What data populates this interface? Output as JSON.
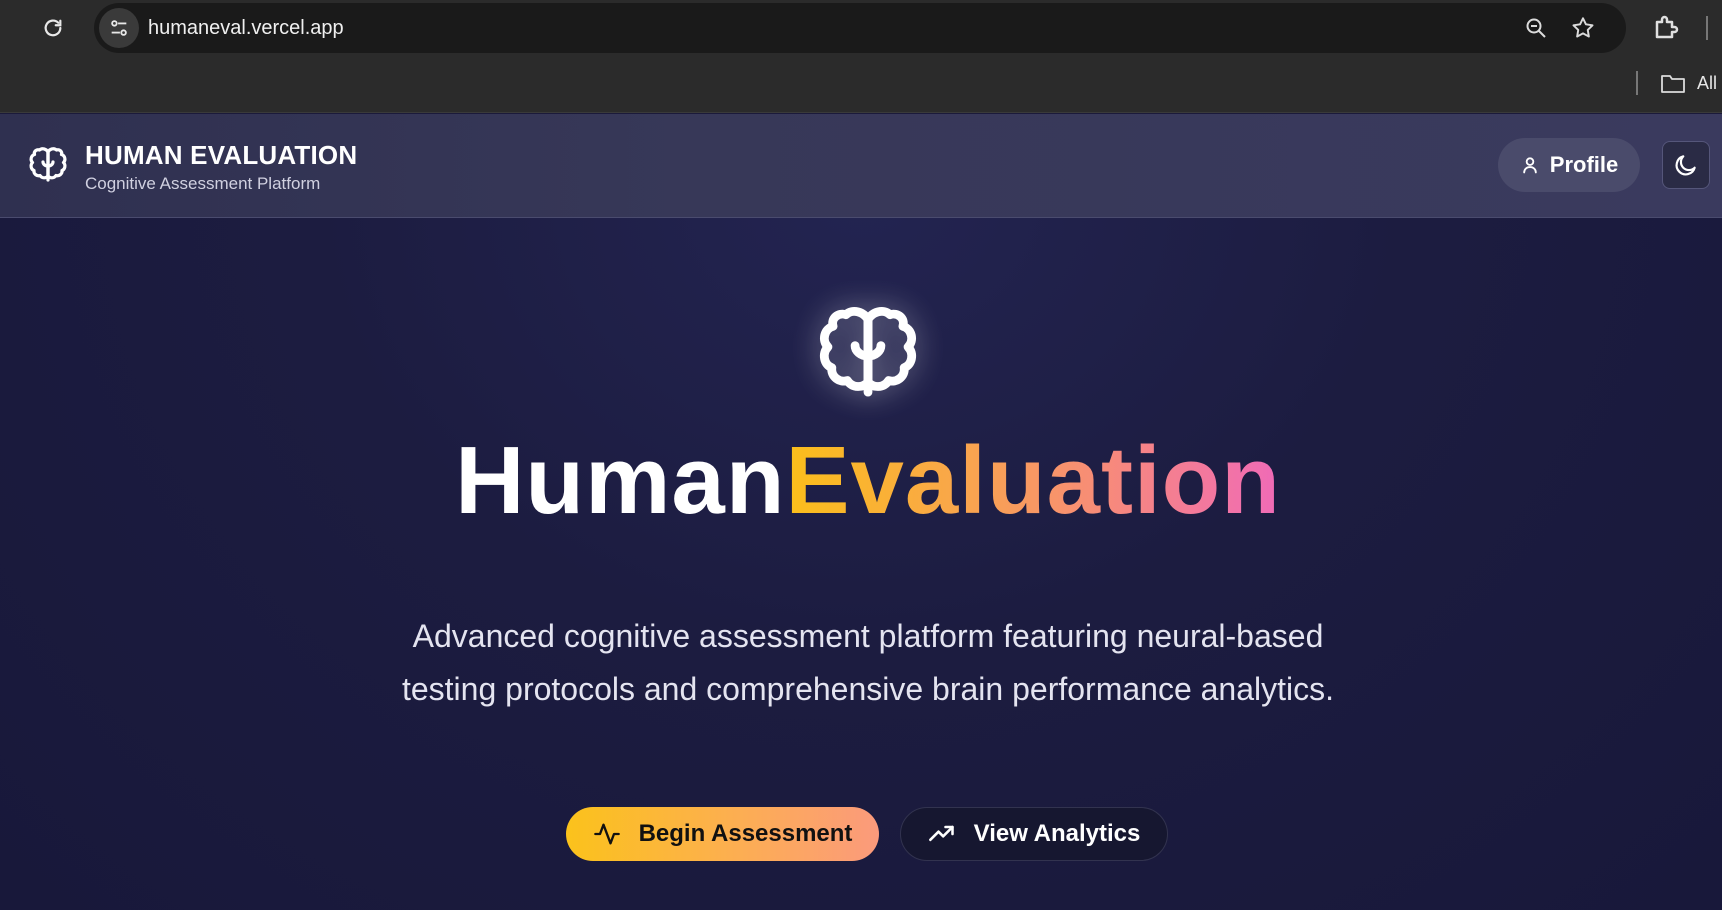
{
  "browser": {
    "url": "humaneval.vercel.app",
    "bookmarks_label": "All"
  },
  "header": {
    "title": "HUMAN EVALUATION",
    "subtitle": "Cognitive Assessment Platform",
    "profile_label": "Profile"
  },
  "hero": {
    "title_part1": "Human",
    "title_part2": "Evaluation",
    "description": "Advanced cognitive assessment platform featuring neural-based testing protocols and comprehensive brain performance analytics.",
    "primary_button": "Begin Assessment",
    "secondary_button": "View Analytics"
  },
  "colors": {
    "accent_yellow": "#fbbf1a",
    "accent_pink": "#f06ab8",
    "background": "#1c1c40"
  }
}
